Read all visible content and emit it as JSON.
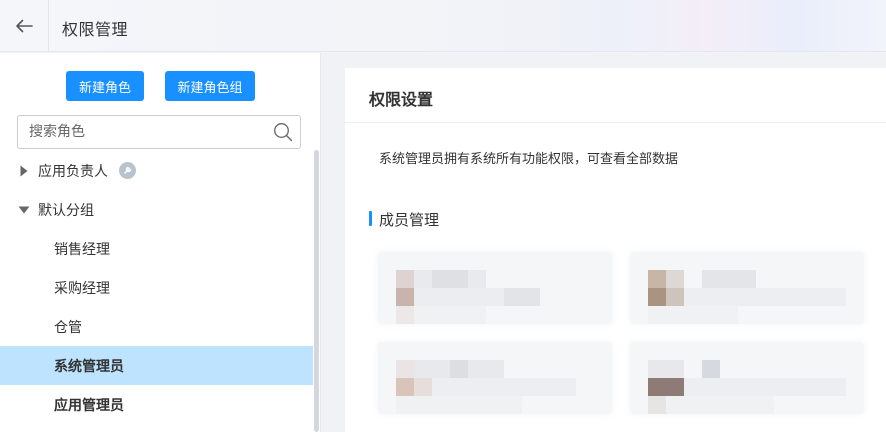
{
  "header": {
    "title": "权限管理",
    "back_icon": "arrow-left-icon"
  },
  "sidebar": {
    "new_role_label": "新建角色",
    "new_group_label": "新建角色组",
    "search": {
      "placeholder": "搜索角色",
      "value": "",
      "icon": "search-icon"
    },
    "groups": [
      {
        "label": "应用负责人",
        "expanded": false,
        "badge_icon": "settings-badge-icon"
      },
      {
        "label": "默认分组",
        "expanded": true
      }
    ],
    "roles": [
      {
        "label": "销售经理",
        "selected": false
      },
      {
        "label": "采购经理",
        "selected": false
      },
      {
        "label": "仓管",
        "selected": false
      },
      {
        "label": "系统管理员",
        "selected": true
      },
      {
        "label": "应用管理员",
        "selected": false
      }
    ]
  },
  "main": {
    "title": "权限设置",
    "description": "系统管理员拥有系统所有功能权限，可查看全部数据",
    "members_section_title": "成员管理",
    "members": [
      {
        "name": "",
        "blurred": true
      },
      {
        "name": "",
        "blurred": true
      },
      {
        "name": "",
        "blurred": true
      },
      {
        "name": "",
        "blurred": true
      }
    ]
  },
  "colors": {
    "accent": "#1890ff",
    "selected_row": "#bde3ff",
    "card_background": "#f5f6f8"
  }
}
